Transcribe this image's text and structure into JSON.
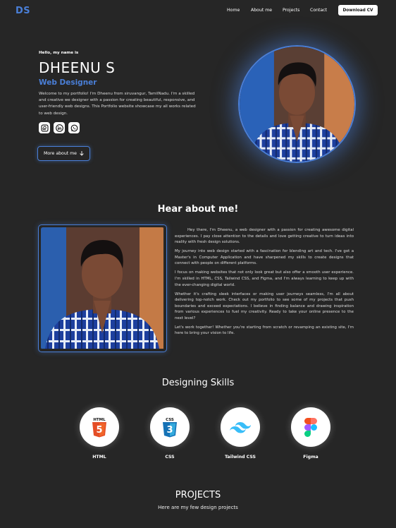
{
  "header": {
    "logo": "DS",
    "nav": [
      "Home",
      "About me",
      "Projects",
      "Contact"
    ],
    "download_label": "Download CV"
  },
  "hero": {
    "greeting": "Hello, my name is",
    "name": "DHEENU S",
    "role": "Web Designer",
    "intro": "Welcome to my portfolio! I'm Dheenu from siruvangur, TamilNadu. I'm a skilled and creative we designer with a passion for creating beautiful, responsive, and user-friendly web designs. This Portfolio website showcase my all works related to web design.",
    "socials": [
      "github-icon",
      "linkedin-icon",
      "whatsapp-icon"
    ],
    "more_label": "More about me"
  },
  "about": {
    "title": "Hear about me!",
    "paragraphs": [
      "Hey there, I'm Dheenu, a web designer with a passion for creating awesome digital experiences. I pay close attention to the details and love getting creative to turn ideas into reality with fresh design solutions.",
      "My journey into web design started with a fascination for blending art and tech. I've got a Master's in Computer Application and have sharpened my skills to create designs that connect with people on different platforms.",
      "I focus on making websites that not only look great but also offer a smooth user experience. I'm skilled in HTML, CSS, Tailwind CSS, and Figma, and I'm always learning to keep up with the ever-changing digital world.",
      "Whether it's crafting sleek interfaces or making user journeys seamless, I'm all about delivering top-notch work. Check out my portfolio to see some of my projects that push boundaries and exceed expectations. I believe in finding balance and drawing inspiration from various experiences to fuel my creativity. Ready to take your online presence to the next level?",
      "Let's work together! Whether you're starting from scratch or revamping an existing site, I'm here to bring your vision to life."
    ]
  },
  "skills": {
    "title": "Designing Skills",
    "items": [
      {
        "label": "HTML",
        "icon": "html5-icon",
        "color": "#e44d26"
      },
      {
        "label": "CSS",
        "icon": "css3-icon",
        "color": "#1572b6"
      },
      {
        "label": "Tailwind CSS",
        "icon": "tailwind-icon",
        "color": "#38bdf8"
      },
      {
        "label": "Figma",
        "icon": "figma-icon",
        "color": "#a259ff"
      }
    ]
  },
  "projects": {
    "title": "PROJECTS",
    "subtitle": "Here are my few design projects"
  },
  "colors": {
    "accent": "#4a7fd8",
    "background": "#262626"
  }
}
